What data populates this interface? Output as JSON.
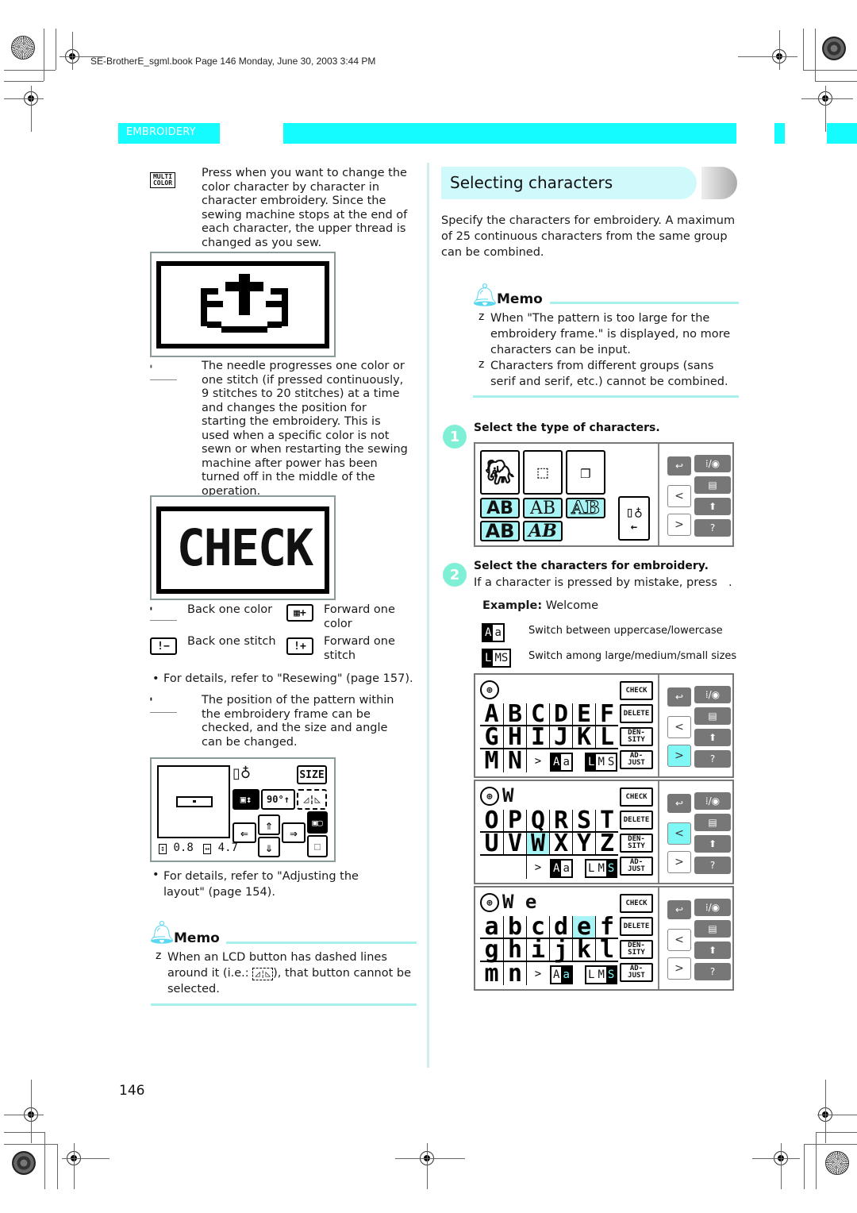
{
  "header": {
    "print_info": "SE-BrotherE_sgml.book  Page 146  Monday, June 30, 2003  3:44 PM",
    "section": "EMBROIDERY",
    "accent_color": "#14fcff"
  },
  "left": {
    "multi_color": {
      "icon_label_line1": "MULTI",
      "icon_label_line2": "COLOR",
      "text": "Press when you want to change the color character by character in character embroidery. Since the sewing machine stops at the end of each character, the upper thread is changed as you sew."
    },
    "needle_progress": {
      "text": "The needle progresses one color or one stitch (if pressed continuously, 9 stitches to 20 stitches) at a time and changes the position for starting the embroidery. This is used when a specific color is not sewn or when restarting the sewing machine after power has been turned off in the middle of the operation."
    },
    "check_lcd": {
      "label": "CHECK"
    },
    "controls": [
      {
        "label": "Back one color",
        "icon": "back-color-icon"
      },
      {
        "label": "Forward one color",
        "icon": "forward-color-icon"
      },
      {
        "label": "Back one stitch",
        "icon": "back-stitch-icon"
      },
      {
        "label": "Forward one stitch",
        "icon": "forward-stitch-icon"
      }
    ],
    "resewing_note": "For details, refer to \"Resewing\" (page 157).",
    "position_text": "The position of the pattern within the embroidery frame can be checked, and the size and angle can be changed.",
    "layout_lcd": {
      "size_label": "SIZE",
      "rotate_label": "90°",
      "height_value": "0.8",
      "width_value": "4.7"
    },
    "layout_note": "For details, refer to \"Adjusting the layout\" (page 154).",
    "memo": {
      "title": "Memo",
      "bullet": "z",
      "text_before": "When an LCD button has dashed lines around it (i.e.: ",
      "text_after": "), that button cannot be selected."
    }
  },
  "right": {
    "title": "Selecting characters",
    "intro": "Specify the characters for embroidery. A maximum of 25 continuous characters from the same group can be combined.",
    "memo": {
      "title": "Memo",
      "bullet": "z",
      "items": [
        "When \"The pattern is too large for the embroidery frame.\" is displayed, no more characters can be input.",
        "Characters from different groups (sans serif and serif, etc.) cannot be combined."
      ]
    },
    "step1": {
      "num": "1",
      "title": "Select the type of characters."
    },
    "type_buttons": [
      "AB",
      "AB",
      "AB",
      "AB",
      "AB"
    ],
    "step2": {
      "num": "2",
      "title": "Select the characters for embroidery.",
      "text": "If a character is pressed by mistake, press",
      "text_end": "."
    },
    "example": {
      "label": "Example:",
      "value": "Welcome"
    },
    "legend": [
      {
        "icon_a": "A",
        "icon_b": "a",
        "text": "Switch between uppercase/lowercase"
      },
      {
        "icon_a": "L",
        "icon_b": "MS",
        "text": "Switch among large/medium/small sizes"
      }
    ],
    "side_buttons": {
      "check": "CHECK",
      "delete": "DELETE",
      "density_1": "DEN-",
      "density_2": "SITY",
      "adjust_1": "AD-",
      "adjust_2": "JUST"
    },
    "panels": [
      {
        "entered": "",
        "rows": [
          [
            "A",
            "B",
            "C",
            "D",
            "E",
            "F"
          ],
          [
            "G",
            "H",
            "I",
            "J",
            "K",
            "L"
          ],
          [
            "M",
            "N",
            ">"
          ]
        ],
        "selected": "",
        "case": "A",
        "size": "L",
        "nav_active": "next"
      },
      {
        "entered": "W",
        "rows": [
          [
            "O",
            "P",
            "Q",
            "R",
            "S",
            "T"
          ],
          [
            "U",
            "V",
            "W",
            "X",
            "Y",
            "Z"
          ],
          [
            ">"
          ]
        ],
        "selected": "W",
        "case": "A",
        "size": "S",
        "nav_active": "prev"
      },
      {
        "entered": "W e",
        "rows": [
          [
            "a",
            "b",
            "c",
            "d",
            "e",
            "f"
          ],
          [
            "g",
            "h",
            "i",
            "j",
            "k",
            "l"
          ],
          [
            "m",
            "n",
            ">"
          ]
        ],
        "selected": "e",
        "case": "a",
        "size": "S",
        "nav_active": ""
      }
    ]
  },
  "footer": {
    "page_number": "146"
  }
}
